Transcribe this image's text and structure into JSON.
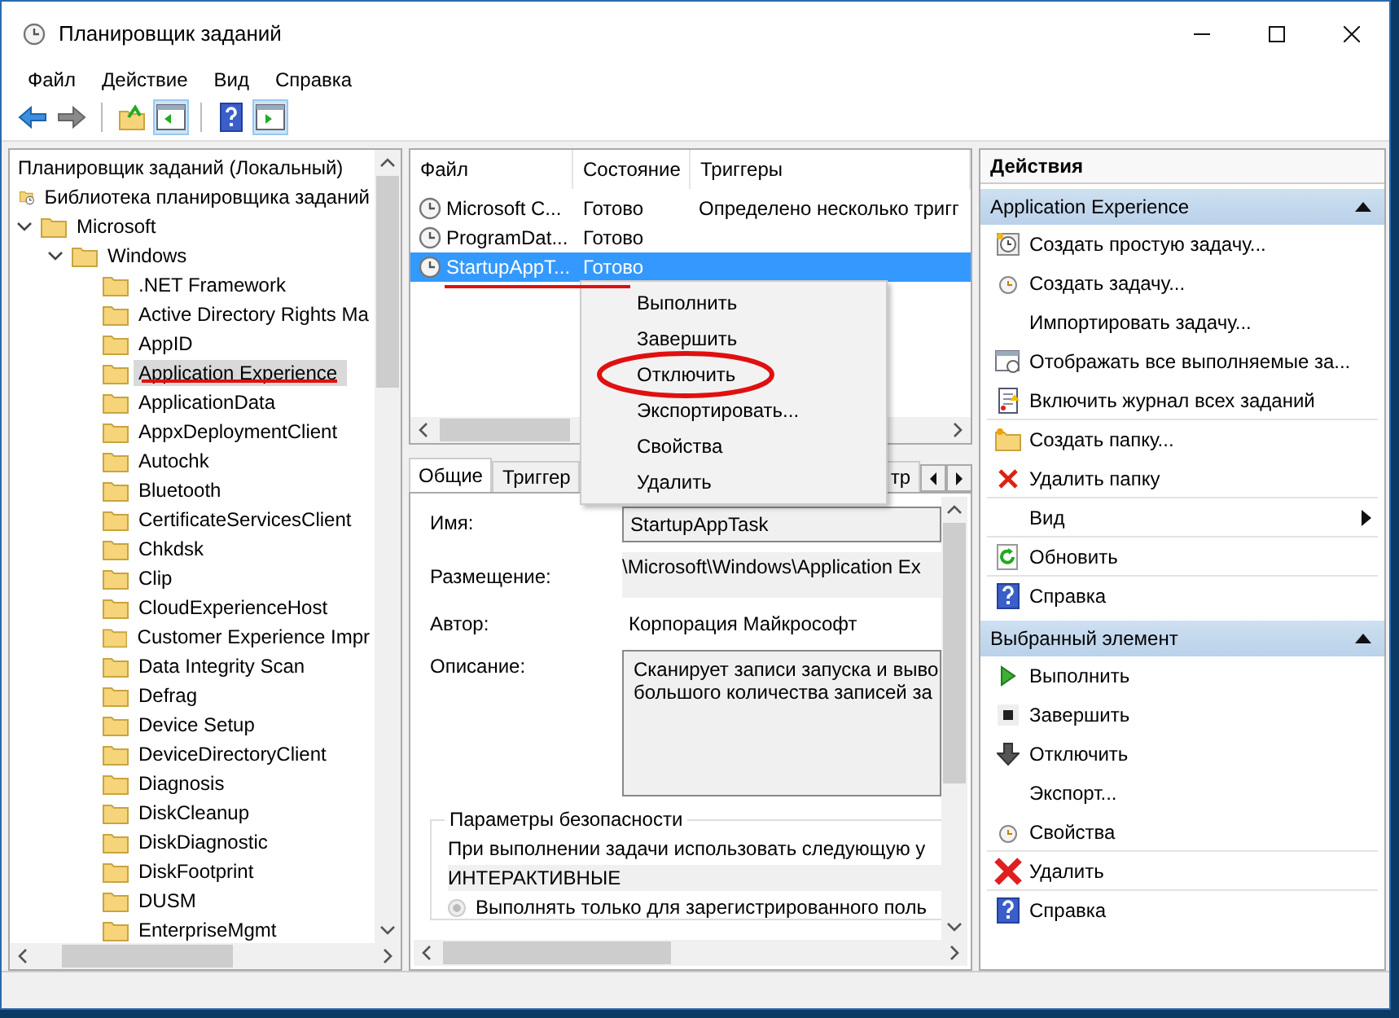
{
  "window": {
    "title": "Планировщик заданий"
  },
  "menu": [
    "Файл",
    "Действие",
    "Вид",
    "Справка"
  ],
  "toolbar": [
    {
      "kind": "back",
      "pressed": false
    },
    {
      "kind": "forward",
      "pressed": false
    },
    {
      "kind": "up",
      "pressed": false
    },
    {
      "kind": "tree-pane",
      "pressed": true
    },
    {
      "kind": "help",
      "pressed": false
    },
    {
      "kind": "action-pane",
      "pressed": true
    }
  ],
  "tree": {
    "header": "Планировщик заданий (Локальный)",
    "items": [
      {
        "label": "Библиотека планировщика заданий",
        "kind": "library",
        "selected": false,
        "children": [
          {
            "label": "Microsoft",
            "kind": "folder",
            "expanded": true,
            "selected": false,
            "children": [
              {
                "label": "Windows",
                "kind": "folder",
                "expanded": true,
                "selected": false,
                "children": [
                  {
                    "label": ".NET Framework",
                    "kind": "folder",
                    "selected": false
                  },
                  {
                    "label": "Active Directory Rights Ma",
                    "kind": "folder",
                    "selected": false
                  },
                  {
                    "label": "AppID",
                    "kind": "folder",
                    "selected": false
                  },
                  {
                    "label": "Application Experience",
                    "kind": "folder",
                    "selected": true
                  },
                  {
                    "label": "ApplicationData",
                    "kind": "folder",
                    "selected": false
                  },
                  {
                    "label": "AppxDeploymentClient",
                    "kind": "folder",
                    "selected": false
                  },
                  {
                    "label": "Autochk",
                    "kind": "folder",
                    "selected": false
                  },
                  {
                    "label": "Bluetooth",
                    "kind": "folder",
                    "selected": false
                  },
                  {
                    "label": "CertificateServicesClient",
                    "kind": "folder",
                    "selected": false
                  },
                  {
                    "label": "Chkdsk",
                    "kind": "folder",
                    "selected": false
                  },
                  {
                    "label": "Clip",
                    "kind": "folder",
                    "selected": false
                  },
                  {
                    "label": "CloudExperienceHost",
                    "kind": "folder",
                    "selected": false
                  },
                  {
                    "label": "Customer Experience Impr",
                    "kind": "folder",
                    "selected": false
                  },
                  {
                    "label": "Data Integrity Scan",
                    "kind": "folder",
                    "selected": false
                  },
                  {
                    "label": "Defrag",
                    "kind": "folder",
                    "selected": false
                  },
                  {
                    "label": "Device Setup",
                    "kind": "folder",
                    "selected": false
                  },
                  {
                    "label": "DeviceDirectoryClient",
                    "kind": "folder",
                    "selected": false
                  },
                  {
                    "label": "Diagnosis",
                    "kind": "folder",
                    "selected": false
                  },
                  {
                    "label": "DiskCleanup",
                    "kind": "folder",
                    "selected": false
                  },
                  {
                    "label": "DiskDiagnostic",
                    "kind": "folder",
                    "selected": false
                  },
                  {
                    "label": "DiskFootprint",
                    "kind": "folder",
                    "selected": false
                  },
                  {
                    "label": "DUSM",
                    "kind": "folder",
                    "selected": false
                  },
                  {
                    "label": "EnterpriseMgmt",
                    "kind": "folder",
                    "selected": false
                  }
                ]
              }
            ]
          }
        ]
      }
    ]
  },
  "tasks": {
    "columns": [
      "Файл",
      "Состояние",
      "Триггеры"
    ],
    "rows": [
      {
        "cells": [
          "Microsoft C...",
          "Готово",
          "Определено несколько тригг"
        ],
        "selected": false
      },
      {
        "cells": [
          "ProgramDat...",
          "Готово",
          ""
        ],
        "selected": false
      },
      {
        "cells": [
          "StartupAppT...",
          "Готово",
          ""
        ],
        "selected": true
      }
    ]
  },
  "context_menu": [
    "Выполнить",
    "Завершить",
    "Отключить",
    "Экспортировать...",
    "Свойства",
    "Удалить"
  ],
  "details": {
    "tabs": [
      {
        "label": "Общие",
        "selected": true
      },
      {
        "label": "Триггер",
        "selected": false
      },
      {
        "label": "тр",
        "selected": false
      }
    ],
    "name_label": "Имя:",
    "name": "StartupAppTask",
    "location_label": "Размещение:",
    "location": "\\Microsoft\\Windows\\Application Ex",
    "author_label": "Автор:",
    "author": "Корпорация Майкрософт",
    "description_label": "Описание:",
    "description": "Сканирует записи запуска и выво\nбольшого количества записей за",
    "security": {
      "title": "Параметры безопасности",
      "text": "При выполнении задачи использовать следующую у",
      "account": "ИНТЕРАКТИВНЫЕ",
      "radio": {
        "label": "Выполнять только для зарегистрированного поль",
        "selected": true,
        "disabled": true
      }
    }
  },
  "actions": {
    "title": "Действия",
    "sections": [
      {
        "title": "Application Experience",
        "expanded": true,
        "items": [
          {
            "label": "Создать простую задачу...",
            "kind": "clock-page",
            "separator_after": false
          },
          {
            "label": "Создать задачу...",
            "kind": "clock",
            "separator_after": false
          },
          {
            "label": "Импортировать задачу...",
            "kind": "none",
            "separator_after": false
          },
          {
            "label": "Отображать все выполняемые за...",
            "kind": "window",
            "separator_after": false
          },
          {
            "label": "Включить журнал всех заданий",
            "kind": "log",
            "separator_after": true
          },
          {
            "label": "Создать папку...",
            "kind": "folder",
            "separator_after": false
          },
          {
            "label": "Удалить папку",
            "kind": "x",
            "separator_after": true
          },
          {
            "label": "Вид",
            "kind": "submenu",
            "separator_after": true
          },
          {
            "label": "Обновить",
            "kind": "refresh",
            "separator_after": true
          },
          {
            "label": "Справка",
            "kind": "help",
            "separator_after": false
          }
        ]
      },
      {
        "title": "Выбранный элемент",
        "expanded": true,
        "items": [
          {
            "label": "Выполнить",
            "kind": "play",
            "separator_after": false
          },
          {
            "label": "Завершить",
            "kind": "stop",
            "separator_after": false
          },
          {
            "label": "Отключить",
            "kind": "down",
            "separator_after": false
          },
          {
            "label": "Экспорт...",
            "kind": "none",
            "separator_after": false
          },
          {
            "label": "Свойства",
            "kind": "clock",
            "separator_after": true
          },
          {
            "label": "Удалить",
            "kind": "big-x",
            "separator_after": true
          },
          {
            "label": "Справка",
            "kind": "help",
            "separator_after": false
          }
        ]
      }
    ]
  }
}
